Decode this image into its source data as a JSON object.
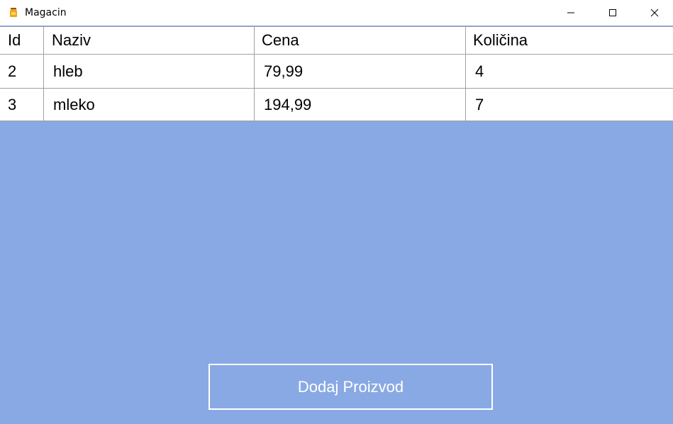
{
  "window": {
    "title": "Magacin",
    "icon": "jar-icon",
    "background": "#89a9e4"
  },
  "table": {
    "columns": [
      "Id",
      "Naziv",
      "Cena",
      "Količina"
    ],
    "rows": [
      [
        "2",
        "hleb",
        "79,99",
        "4"
      ],
      [
        "3",
        "mleko",
        "194,99",
        "7"
      ]
    ]
  },
  "actions": {
    "add_label": "Dodaj Proizvod"
  }
}
